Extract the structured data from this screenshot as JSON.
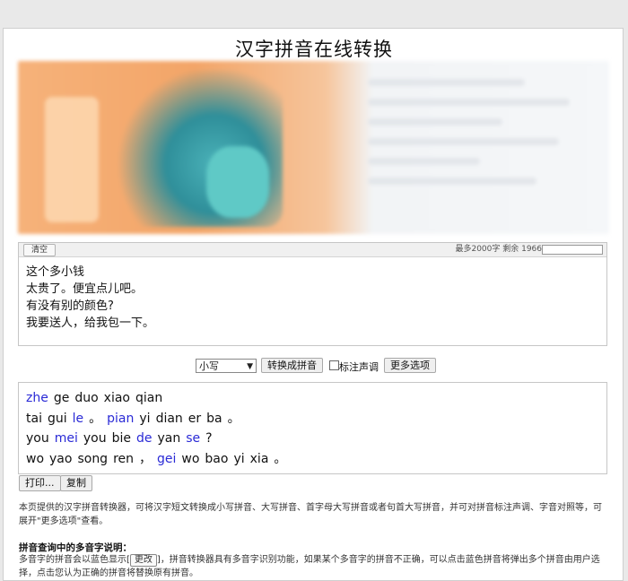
{
  "page": {
    "title": "汉字拼音在线转换"
  },
  "input": {
    "clear_label": "清空",
    "counter_text": "最多2000字 剩余 1966",
    "lines": [
      "这个多小钱",
      "太贵了。便宜点儿吧。",
      "有没有别的颜色?",
      "我要送人，给我包一下。"
    ]
  },
  "controls": {
    "case_select_value": "小写",
    "convert_label": "转换成拼音",
    "tone_label": "标注声调",
    "more_options_label": "更多选项"
  },
  "output": {
    "lines": [
      [
        {
          "t": "zhe",
          "blue": true
        },
        {
          "t": "ge"
        },
        {
          "t": "duo"
        },
        {
          "t": "xiao"
        },
        {
          "t": "qian"
        }
      ],
      [
        {
          "t": "tai"
        },
        {
          "t": "gui"
        },
        {
          "t": "le",
          "blue": true
        },
        {
          "t": "。"
        },
        {
          "t": "pian",
          "blue": true
        },
        {
          "t": "yi"
        },
        {
          "t": "dian"
        },
        {
          "t": "er"
        },
        {
          "t": "ba"
        },
        {
          "t": "。"
        }
      ],
      [
        {
          "t": "you"
        },
        {
          "t": "mei",
          "blue": true
        },
        {
          "t": "you"
        },
        {
          "t": "bie"
        },
        {
          "t": "de",
          "blue": true
        },
        {
          "t": "yan"
        },
        {
          "t": "se",
          "blue": true
        },
        {
          "t": "?"
        }
      ],
      [
        {
          "t": "wo"
        },
        {
          "t": "yao"
        },
        {
          "t": "song"
        },
        {
          "t": "ren"
        },
        {
          "t": "，"
        },
        {
          "t": "gei",
          "blue": true
        },
        {
          "t": "wo"
        },
        {
          "t": "bao"
        },
        {
          "t": "yi"
        },
        {
          "t": "xia"
        },
        {
          "t": "。"
        }
      ]
    ],
    "print_label": "打印...",
    "copy_label": "复制"
  },
  "info": {
    "description": "本页提供的汉字拼音转换器，可将汉字短文转换成小写拼音、大写拼音、首字母大写拼音或者句首大写拼音，并可对拼音标注声调、字音对照等，可展开\"更多选项\"查看。",
    "polyphone_heading": "拼音查询中的多音字说明：",
    "polyphone_text_before": "多音字的拼音会以蓝色显示",
    "polyphone_button": "更改",
    "polyphone_text_after": "，拼音转换器具有多音字识别功能，如果某个多音字的拼音不正确，可以点击蓝色拼音将弹出多个拼音由用户选择，点击您认为正确的拼音将替换原有拼音。"
  },
  "colors": {
    "polyphone_blue": "#2a2ad6"
  }
}
